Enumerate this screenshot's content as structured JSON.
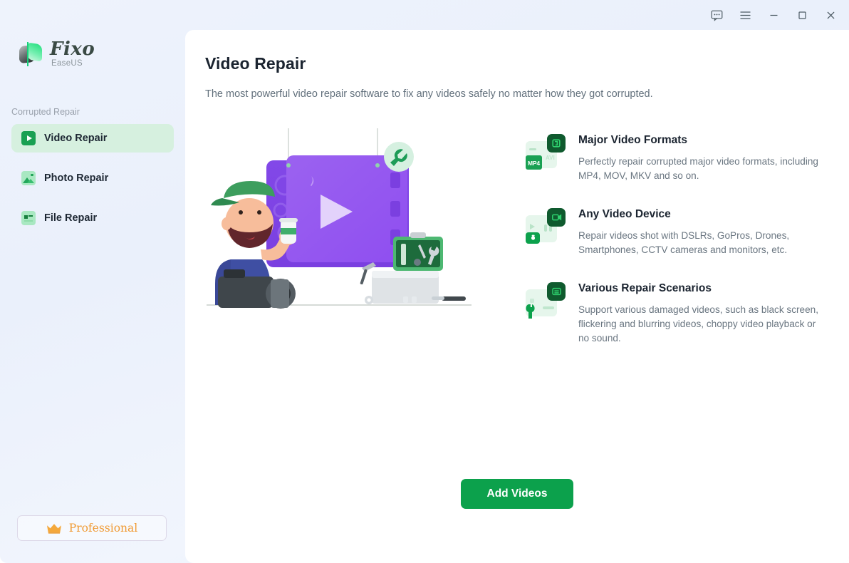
{
  "window": {
    "titlebar_buttons": [
      {
        "name": "feedback-icon",
        "label": "Feedback"
      },
      {
        "name": "menu-icon",
        "label": "Menu"
      },
      {
        "name": "minimize-icon",
        "label": "Minimize"
      },
      {
        "name": "maximize-icon",
        "label": "Maximize"
      },
      {
        "name": "close-icon",
        "label": "Close"
      }
    ]
  },
  "sidebar": {
    "logo": {
      "name": "Fixo",
      "brand": "EaseUS",
      "icon": "fixo-logo-icon"
    },
    "group_title": "Corrupted Repair",
    "items": [
      {
        "label": "Video Repair",
        "icon": "video-repair-icon",
        "active": true
      },
      {
        "label": "Photo Repair",
        "icon": "photo-repair-icon",
        "active": false
      },
      {
        "label": "File Repair",
        "icon": "file-repair-icon",
        "active": false
      }
    ],
    "pro_button": {
      "label": "Professional",
      "icon": "crown-icon"
    }
  },
  "main": {
    "title": "Video Repair",
    "subtitle": "The most powerful video repair software to fix any videos safely no matter how they got corrupted.",
    "illustration": {
      "name": "video-repair-illustration",
      "alt": "Videographer holding coffee beside a purple video player and a toolbox"
    },
    "features": [
      {
        "title": "Major Video Formats",
        "desc": "Perfectly repair corrupted major video formats, including MP4, MOV, MKV and so on.",
        "icon": "video-formats-icon",
        "badges": [
          "MP4",
          "AVI"
        ]
      },
      {
        "title": "Any Video Device",
        "desc": "Repair videos shot with DSLRs, GoPros, Drones, Smartphones, CCTV cameras and monitors, etc.",
        "icon": "video-device-icon",
        "badges": []
      },
      {
        "title": "Various Repair Scenarios",
        "desc": "Support various damaged videos, such as black screen, flickering and blurring videos, choppy video playback or no sound.",
        "icon": "repair-scenarios-icon",
        "badges": []
      }
    ],
    "cta": {
      "label": "Add Videos"
    }
  },
  "colors": {
    "accent_green": "#0ca14c",
    "dark_green": "#0f5a2e",
    "light_green": "#d6f0df",
    "pro_orange": "#f09a33",
    "sidebar_bg": "#eef3fc",
    "text_primary": "#1b2430",
    "text_secondary": "#6a7681"
  }
}
